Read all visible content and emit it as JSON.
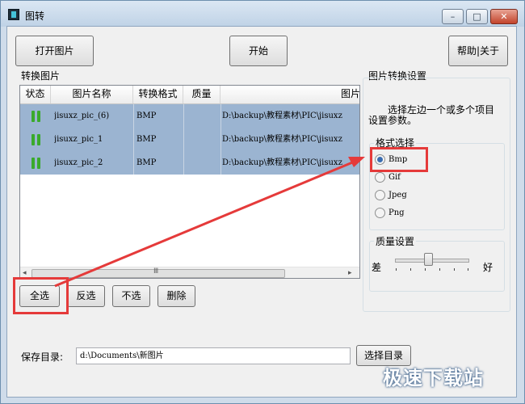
{
  "window": {
    "title": "图转"
  },
  "toolbar": {
    "open_label": "打开图片",
    "start_label": "开始",
    "help_label": "帮助|关于"
  },
  "list": {
    "group_label": "转换图片",
    "columns": [
      "状态",
      "图片名称",
      "转换格式",
      "质量",
      "图片地址"
    ],
    "rows": [
      {
        "name": "jisuxz_pic_(6)",
        "format": "BMP",
        "quality": "",
        "path": "D:\\backup\\教程素材\\PIC\\jisuxz"
      },
      {
        "name": "jisuxz_pic_1",
        "format": "BMP",
        "quality": "",
        "path": "D:\\backup\\教程素材\\PIC\\jisuxz"
      },
      {
        "name": "jisuxz_pic_2",
        "format": "BMP",
        "quality": "",
        "path": "D:\\backup\\教程素材\\PIC\\jisuxz"
      }
    ],
    "scroll_glyph": "Ⅲ"
  },
  "actions": {
    "select_all": "全选",
    "invert": "反选",
    "select_none": "不选",
    "delete": "删除"
  },
  "settings": {
    "title": "图片转换设置",
    "hint_line1": "选择左边一个或多个项目",
    "hint_line2": "设置参数。",
    "format_group": "格式选择",
    "formats": [
      "Bmp",
      "Gif",
      "Jpeg",
      "Png"
    ],
    "selected_format": "Bmp",
    "quality_group": "质量设置",
    "quality_low": "差",
    "quality_high": "好",
    "quality_level": 0.45
  },
  "save": {
    "label": "保存目录:",
    "path": "d:\\Documents\\新图片",
    "browse_label": "选择目录"
  },
  "watermark": "极速下载站",
  "colors": {
    "selection": "#9bb4d1",
    "annotation_red": "#e53a3a",
    "status_green": "#3aaa2c"
  }
}
